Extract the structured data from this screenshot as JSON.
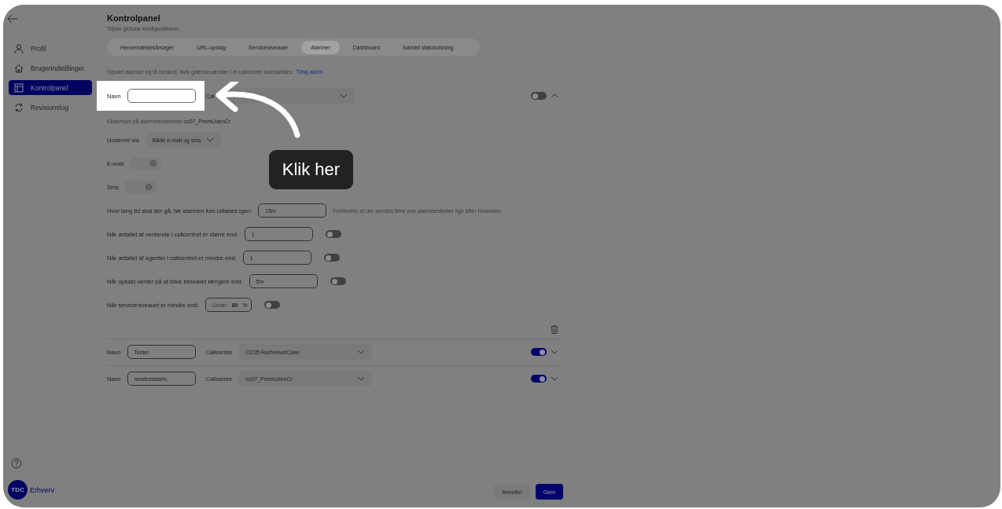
{
  "header": {
    "title": "Kontrolpanel",
    "subtitle": "Tilpas globale konfigurationer."
  },
  "sidebar": {
    "items": [
      {
        "label": "Profil",
        "selected": false
      },
      {
        "label": "Brugerindstillinger",
        "selected": false
      },
      {
        "label": "Kontrolpanel",
        "selected": true
      },
      {
        "label": "Revisionslog",
        "selected": false
      }
    ]
  },
  "tabs": [
    {
      "label": "Henvendelsesårsager",
      "selected": false
    },
    {
      "label": "URL-opslag",
      "selected": false
    },
    {
      "label": "Serviceniveauer",
      "selected": false
    },
    {
      "label": "Alarmer",
      "selected": true
    },
    {
      "label": "Dashboard",
      "selected": false
    },
    {
      "label": "Samlet statusvisning",
      "selected": false
    }
  ],
  "intro": {
    "text": "Opsæt alarmer og få besked, hvis grænseværdier i et callcenter overskrides.",
    "link": "Tilføj alarm"
  },
  "alarms": [
    {
      "name_label": "Navn",
      "callcentre_label": "Cal",
      "enabled": false,
      "expanded": true,
      "spotlight": true
    },
    {
      "name_label": "Navn",
      "name_value": "Tester",
      "callcentre_label": "Callcentre",
      "callcentre_value": "CC05 RedVelvetCake",
      "enabled": true,
      "expanded": false,
      "spotlight": false
    },
    {
      "name_label": "Navn",
      "name_value": "newtestalarm",
      "callcentre_label": "Callcentre",
      "callcentre_value": "cc07_PremUdenCr",
      "enabled": true,
      "expanded": false,
      "spotlight": false
    }
  ],
  "details": {
    "example_label": "Eksempel på alarmmeddelelse:",
    "example_value": "cc07_PremUdenCr",
    "notify_label": "Underret via",
    "notify_value": "Både e-mail og sms",
    "email_label": "E-mail",
    "sms_label": "Sms",
    "rules": [
      {
        "kind": "hint",
        "label": "Hvor lang tid skal der gå, før alarmen kan udløses igen:",
        "value": "15m",
        "hint": "Forhindrer at der sendes flere ens alarmbeskeder lige efter hinanden."
      },
      {
        "kind": "toggle",
        "label": "Når antallet af ventende i callcentret er større end:",
        "value": "1",
        "on": false
      },
      {
        "kind": "toggle",
        "label": "Når antallet af agenter i callcentret er mindre end:",
        "value": "1",
        "on": false
      },
      {
        "kind": "toggle",
        "label": "Når opkald venter på at blive besvaret længere end:",
        "value": "5m",
        "on": false
      },
      {
        "kind": "percent",
        "label": "Når serviceniveauet er mindre end:",
        "prefix": "Under",
        "value": "80",
        "suffix": "%",
        "on": false
      }
    ]
  },
  "tooltip": {
    "text": "Klik her"
  },
  "logo": {
    "mark": "TDC",
    "text": "Erhverv"
  },
  "buttons": [
    {
      "label": "Annuller",
      "kind": "secondary"
    },
    {
      "label": "Gem",
      "kind": "primary"
    }
  ]
}
